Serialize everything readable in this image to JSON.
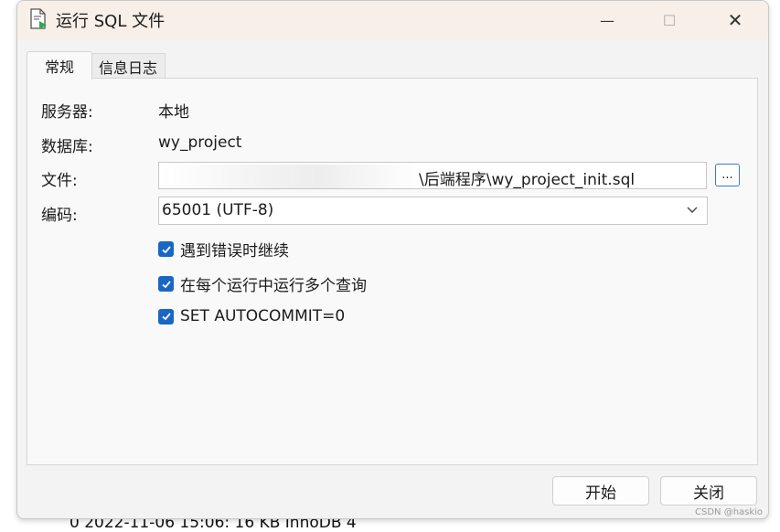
{
  "window": {
    "title": "运行 SQL 文件",
    "minimize_glyph": "—",
    "maximize_glyph": "☐",
    "close_glyph": "✕"
  },
  "tabs": [
    {
      "label": "常规",
      "active": true
    },
    {
      "label": "信息日志",
      "active": false
    }
  ],
  "form": {
    "server_label": "服务器:",
    "server_value": "本地",
    "database_label": "数据库:",
    "database_value": "wy_project",
    "file_label": "文件:",
    "file_value_visible": "\\后端程序\\wy_project_init.sql",
    "browse_label": "...",
    "encoding_label": "编码:",
    "encoding_value": "65001 (UTF-8)"
  },
  "options": [
    {
      "label": "遇到错误时继续",
      "checked": true
    },
    {
      "label": "在每个运行中运行多个查询",
      "checked": true
    },
    {
      "label": "SET AUTOCOMMIT=0",
      "checked": true
    }
  ],
  "buttons": {
    "start": "开始",
    "close": "关闭"
  },
  "background_row": {
    "text": "0   2022-11-06 15:06:              16 KB  InnoDB                               4"
  },
  "watermark": "CSDN @haskio",
  "colors": {
    "titlebar": "#f7efe8",
    "accent": "#1a66c4",
    "panel": "#f9f9f9"
  }
}
